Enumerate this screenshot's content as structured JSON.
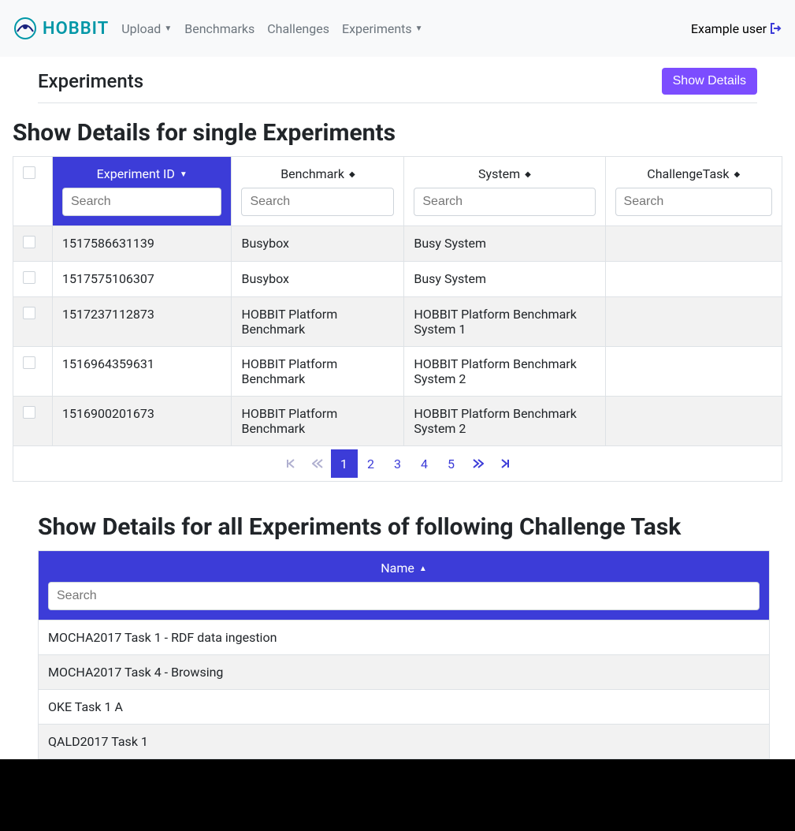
{
  "nav": {
    "brand": "HOBBIT",
    "links": {
      "upload": "Upload",
      "benchmarks": "Benchmarks",
      "challenges": "Challenges",
      "experiments": "Experiments"
    },
    "user": "Example user"
  },
  "header": {
    "title": "Experiments",
    "show_details_btn": "Show Details"
  },
  "section1": {
    "title": "Show Details for single Experiments",
    "columns": {
      "experiment_id": "Experiment ID",
      "benchmark": "Benchmark",
      "system": "System",
      "challenge_task": "ChallengeTask"
    },
    "search_placeholder": "Search",
    "rows": [
      {
        "id": "1517586631139",
        "benchmark": "Busybox",
        "system": "Busy System",
        "task": ""
      },
      {
        "id": "1517575106307",
        "benchmark": "Busybox",
        "system": "Busy System",
        "task": ""
      },
      {
        "id": "1517237112873",
        "benchmark": "HOBBIT Platform Benchmark",
        "system": "HOBBIT Platform Benchmark System 1",
        "task": ""
      },
      {
        "id": "1516964359631",
        "benchmark": "HOBBIT Platform Benchmark",
        "system": "HOBBIT Platform Benchmark System 2",
        "task": ""
      },
      {
        "id": "1516900201673",
        "benchmark": "HOBBIT Platform Benchmark",
        "system": "HOBBIT Platform Benchmark System 2",
        "task": ""
      }
    ],
    "pages": [
      "1",
      "2",
      "3",
      "4",
      "5"
    ]
  },
  "section2": {
    "title": "Show Details for all Experiments of following Challenge Task",
    "column_name": "Name",
    "search_placeholder": "Search",
    "rows": [
      "MOCHA2017 Task 1 - RDF data ingestion",
      "MOCHA2017 Task 4 - Browsing",
      "OKE Task 1 A",
      "QALD2017 Task 1"
    ]
  }
}
